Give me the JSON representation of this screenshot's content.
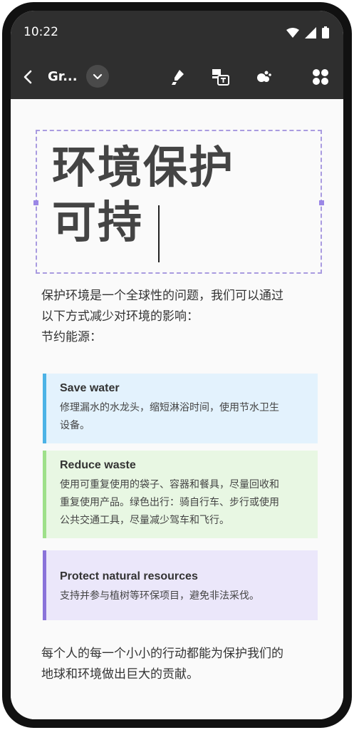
{
  "status": {
    "time": "10:22"
  },
  "toolbar": {
    "title": "Gr..."
  },
  "document": {
    "title_lines": [
      "环境保护",
      "可持"
    ],
    "intro_lines": [
      "保护环境是一个全球性的问题，我们可以通过",
      "以下方式减少对环境的影响：",
      "节约能源："
    ],
    "cards": [
      {
        "title": "Save water",
        "lines": [
          "修理漏水的水龙头，缩短淋浴时间，使用节水卫生",
          "设备。"
        ],
        "accent": "#4db3e6",
        "bg": "#e3f2fd"
      },
      {
        "title": "Reduce waste",
        "lines": [
          "使用可重复使用的袋子、容器和餐具，尽量回收和",
          "重复使用产品。绿色出行：骑自行车、步行或使用",
          "公共交通工具，尽量减少驾车和飞行。"
        ],
        "accent": "#9ee08a",
        "bg": "#e8f7e3"
      },
      {
        "title": "Protect natural resources",
        "lines": [
          "支持并参与植树等环保项目，避免非法采伐。"
        ],
        "accent": "#8a73d9",
        "bg": "#ebe7fa"
      }
    ],
    "closing_lines": [
      "每个人的每一个小小的行动都能为保护我们的",
      "地球和环境做出巨大的贡献。"
    ]
  }
}
